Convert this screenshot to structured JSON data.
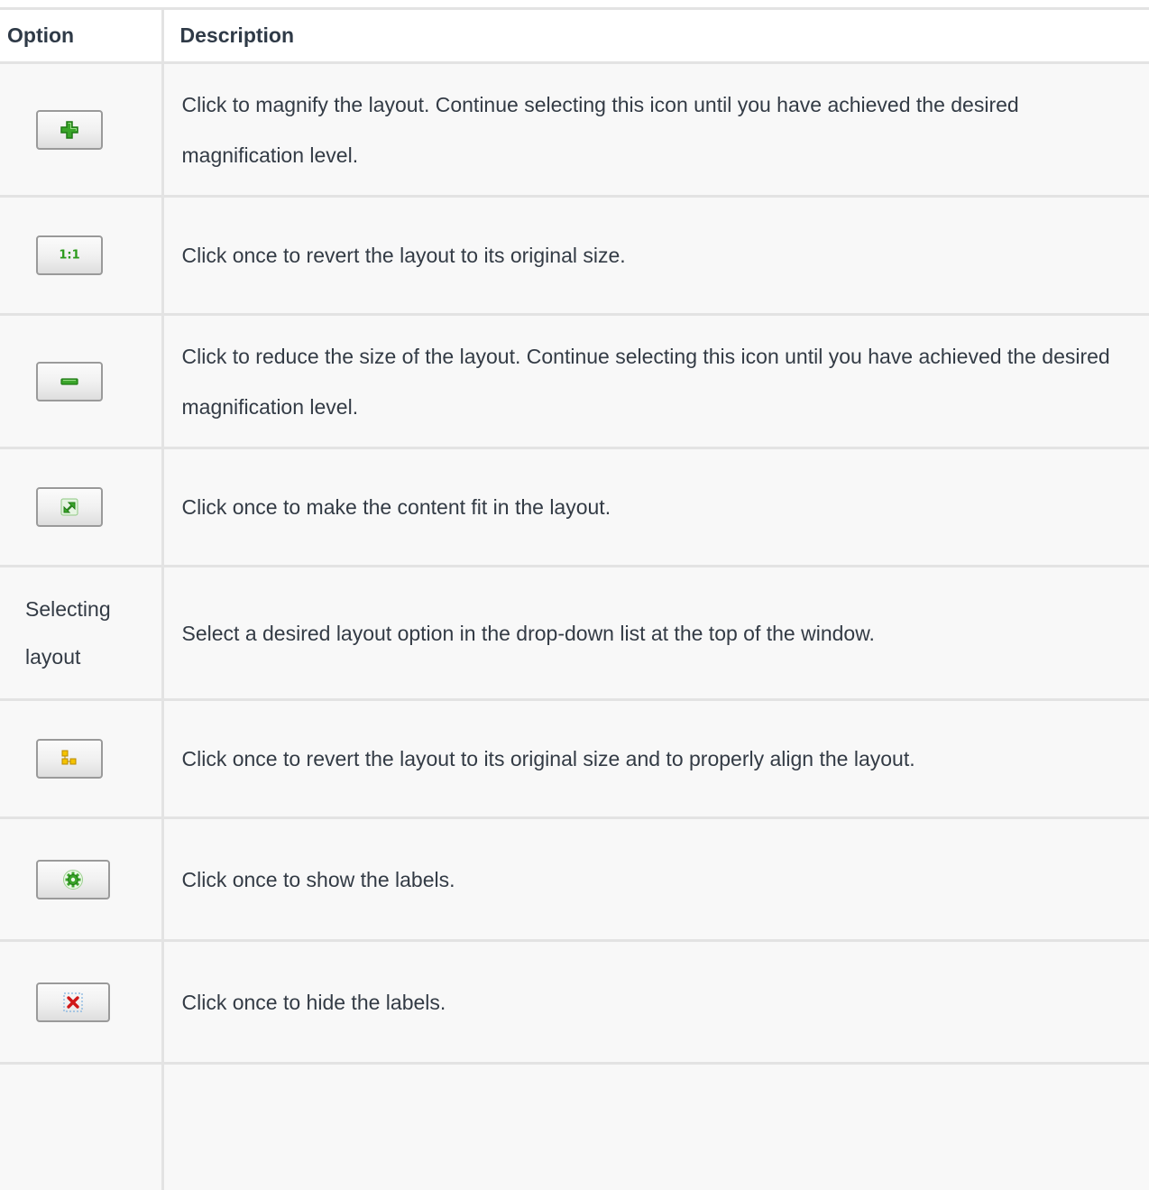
{
  "table": {
    "headers": {
      "option": "Option",
      "description": "Description"
    },
    "rows": [
      {
        "option_icon": "zoom-in-icon",
        "option_text": "",
        "description": "Click to magnify the layout. Continue selecting this icon until you have achieved the desired magnification level."
      },
      {
        "option_icon": "actual-size-icon",
        "option_text": "",
        "icon_text": "1:1",
        "description": "Click once to revert the layout to its original size."
      },
      {
        "option_icon": "zoom-out-icon",
        "option_text": "",
        "description": "Click to reduce the size of the layout. Continue selecting this icon until you have achieved the desired magnification level."
      },
      {
        "option_icon": "fit-content-icon",
        "option_text": "",
        "description": "Click once to make the content fit in the layout."
      },
      {
        "option_icon": "",
        "option_text": "Selecting layout",
        "description": "Select a desired layout option in the drop-down list at the top of the window."
      },
      {
        "option_icon": "align-layout-icon",
        "option_text": "",
        "description": "Click once to revert the layout to its original size and to properly align the layout."
      },
      {
        "option_icon": "show-labels-icon",
        "option_text": "",
        "description": "Click once to show the labels."
      },
      {
        "option_icon": "hide-labels-icon",
        "option_text": "",
        "description": "Click once to hide the labels."
      },
      {
        "option_icon": "",
        "option_text": "",
        "description": ""
      }
    ]
  },
  "colors": {
    "icon_green": "#3aa52a",
    "icon_yellow": "#e8b400",
    "icon_red": "#d01818",
    "border": "#e3e3e3",
    "row_background": "#f8f8f8"
  }
}
